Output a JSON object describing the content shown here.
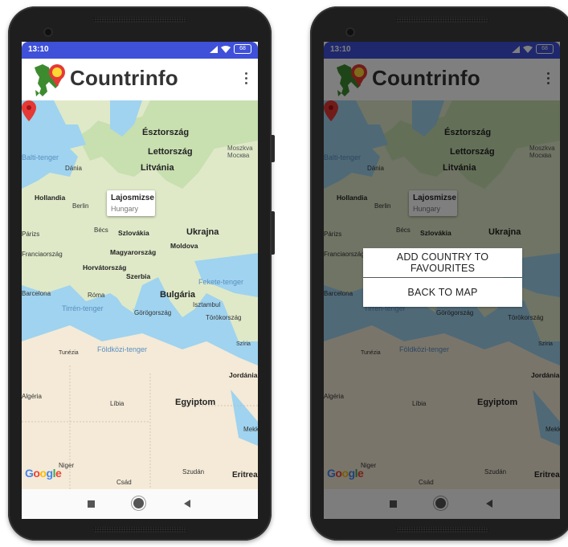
{
  "status": {
    "time": "13:10",
    "battery": "68"
  },
  "app": {
    "title": "Countrinfo"
  },
  "map": {
    "labels": {
      "esztorszag": "Észtország",
      "lettorszag": "Lettország",
      "moszkva": "Moszkva",
      "moscow": "Москва",
      "baltic_sea": "Balti-tenger",
      "dania": "Dánia",
      "litvania": "Litvánia",
      "hollandia": "Hollandia",
      "berlin": "Berlin",
      "parizs": "Párizs",
      "becs": "Bécs",
      "szlovakia": "Szlovákia",
      "ukrajna": "Ukrajna",
      "moldova": "Moldova",
      "franciaorszag": "Franciaország",
      "magyarorszag": "Magyarország",
      "horvatorszag": "Horvátország",
      "szerbia": "Szerbia",
      "fekete_tenger": "Fekete-tenger",
      "barcelona": "Barcelona",
      "roma": "Róma",
      "bulgaria": "Bulgária",
      "isztambul": "Isztambul",
      "tirren_tenger": "Tirrén-tenger",
      "gorogorszag": "Görögország",
      "torokorszag": "Törökország",
      "tunezia": "Tunézia",
      "foldkozi_tenger": "Földközi-tenger",
      "szira": "Szíria",
      "jordania": "Jordánia",
      "algeria": "Algéria",
      "libia": "Líbia",
      "egyiptom": "Egyiptom",
      "mekka": "Mekka",
      "niger": "Niger",
      "csad": "Csád",
      "szudan": "Szudán",
      "eritrea": "Eritrea"
    },
    "marker_info": {
      "title": "Lajosmizse",
      "subtitle": "Hungary"
    },
    "attribution": {
      "g1": "G",
      "g2": "o",
      "g3": "o",
      "g4": "g",
      "g5": "l",
      "g6": "e"
    }
  },
  "dialog": {
    "add_favourite_label": "ADD COUNTRY TO FAVOURITES",
    "back_label": "BACK TO MAP"
  },
  "colors": {
    "statusbar": "#3f51d8",
    "marker": "#e53935",
    "land": "#dfe9c8",
    "water": "#9fd3ef"
  }
}
